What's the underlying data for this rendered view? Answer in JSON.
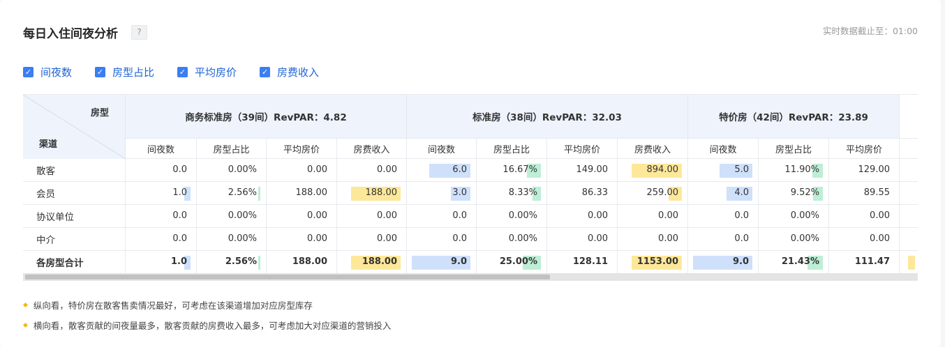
{
  "header": {
    "title": "每日入住间夜分析",
    "help_icon": "?",
    "updated_label": "实时数据截止至：",
    "updated_time": "01:00"
  },
  "filters": [
    {
      "label": "间夜数",
      "checked": true
    },
    {
      "label": "房型占比",
      "checked": true
    },
    {
      "label": "平均房价",
      "checked": true
    },
    {
      "label": "房费收入",
      "checked": true
    }
  ],
  "table": {
    "corner_top": "房型",
    "corner_bottom": "渠道",
    "groups": [
      {
        "title": "商务标准房（39间）RevPAR：4.82"
      },
      {
        "title": "标准房（38间）RevPAR：32.03"
      },
      {
        "title": "特价房（42间）RevPAR：23.89"
      }
    ],
    "sub_headers": [
      "间夜数",
      "房型占比",
      "平均房价",
      "房费收入",
      "间夜数",
      "房型占比",
      "平均房价",
      "房费收入",
      "间夜数",
      "房型占比",
      "平均房价"
    ],
    "rows": [
      {
        "label": "散客",
        "bold": false,
        "cells": [
          "0.0",
          "0.00%",
          "0.00",
          "0.00",
          "6.0",
          "16.67%",
          "149.00",
          "894.00",
          "5.0",
          "11.90%",
          "129.00"
        ]
      },
      {
        "label": "会员",
        "bold": false,
        "cells": [
          "1.0",
          "2.56%",
          "188.00",
          "188.00",
          "3.0",
          "8.33%",
          "86.33",
          "259.00",
          "4.0",
          "9.52%",
          "89.55"
        ]
      },
      {
        "label": "协议单位",
        "bold": false,
        "cells": [
          "0.0",
          "0.00%",
          "0.00",
          "0.00",
          "0.0",
          "0.00%",
          "0.00",
          "0.00",
          "0.0",
          "0.00%",
          "0.00"
        ]
      },
      {
        "label": "中介",
        "bold": false,
        "cells": [
          "0.0",
          "0.00%",
          "0.00",
          "0.00",
          "0.0",
          "0.00%",
          "0.00",
          "0.00",
          "0.0",
          "0.00%",
          "0.00"
        ]
      },
      {
        "label": "各房型合计",
        "bold": true,
        "cells": [
          "1.0",
          "2.56%",
          "188.00",
          "188.00",
          "9.0",
          "25.00%",
          "128.11",
          "1153.00",
          "9.0",
          "21.43%",
          "111.47"
        ]
      }
    ],
    "bar_levels": [
      [
        0,
        0,
        0,
        0,
        0.7,
        0.23,
        0,
        0.85,
        0.55,
        0.18,
        0
      ],
      [
        0.11,
        0.02,
        0,
        0.85,
        0.33,
        0.14,
        0,
        0.22,
        0.44,
        0.16,
        0
      ],
      [
        0,
        0,
        0,
        0,
        0,
        0,
        0,
        0,
        0,
        0,
        0
      ],
      [
        0,
        0,
        0,
        0,
        0,
        0,
        0,
        0,
        0,
        0,
        0
      ],
      [
        0.11,
        0.04,
        0,
        0.85,
        1.0,
        0.3,
        0,
        0.85,
        1.0,
        0.26,
        0
      ]
    ],
    "bar_colors": {
      "nights": "#cfe0fb",
      "share": "#bdeed6",
      "revenue": "#fde89a"
    }
  },
  "notes": [
    "纵向看，特价房在散客售卖情况最好，可考虑在该渠道增加对应房型库存",
    "横向看，散客贡献的间夜量最多，散客贡献的房费收入最多，可考虑加大对应渠道的营销投入"
  ]
}
